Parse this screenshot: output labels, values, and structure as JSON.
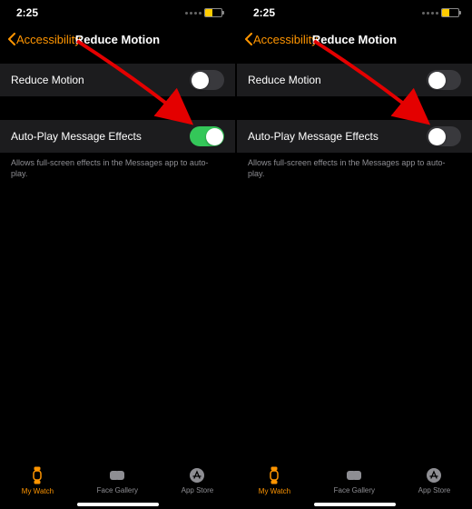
{
  "screens": [
    {
      "status": {
        "time": "2:25",
        "battery_pct": 45,
        "battery_color": "#ffcc00"
      },
      "nav": {
        "back": "Accessibility",
        "title": "Reduce Motion"
      },
      "rows": [
        {
          "label": "Reduce Motion",
          "enabled": false
        },
        {
          "label": "Auto-Play Message Effects",
          "enabled": true
        }
      ],
      "caption": "Allows full-screen effects in the Messages app to auto-play.",
      "arrow_target": 1
    },
    {
      "status": {
        "time": "2:25",
        "battery_pct": 45,
        "battery_color": "#ffcc00"
      },
      "nav": {
        "back": "Accessibility",
        "title": "Reduce Motion"
      },
      "rows": [
        {
          "label": "Reduce Motion",
          "enabled": false
        },
        {
          "label": "Auto-Play Message Effects",
          "enabled": false
        }
      ],
      "caption": "Allows full-screen effects in the Messages app to auto-play.",
      "arrow_target": 1
    }
  ],
  "tabs": [
    {
      "label": "My Watch",
      "active": true,
      "icon": "watch"
    },
    {
      "label": "Face Gallery",
      "active": false,
      "icon": "gallery"
    },
    {
      "label": "App Store",
      "active": false,
      "icon": "appstore"
    }
  ]
}
